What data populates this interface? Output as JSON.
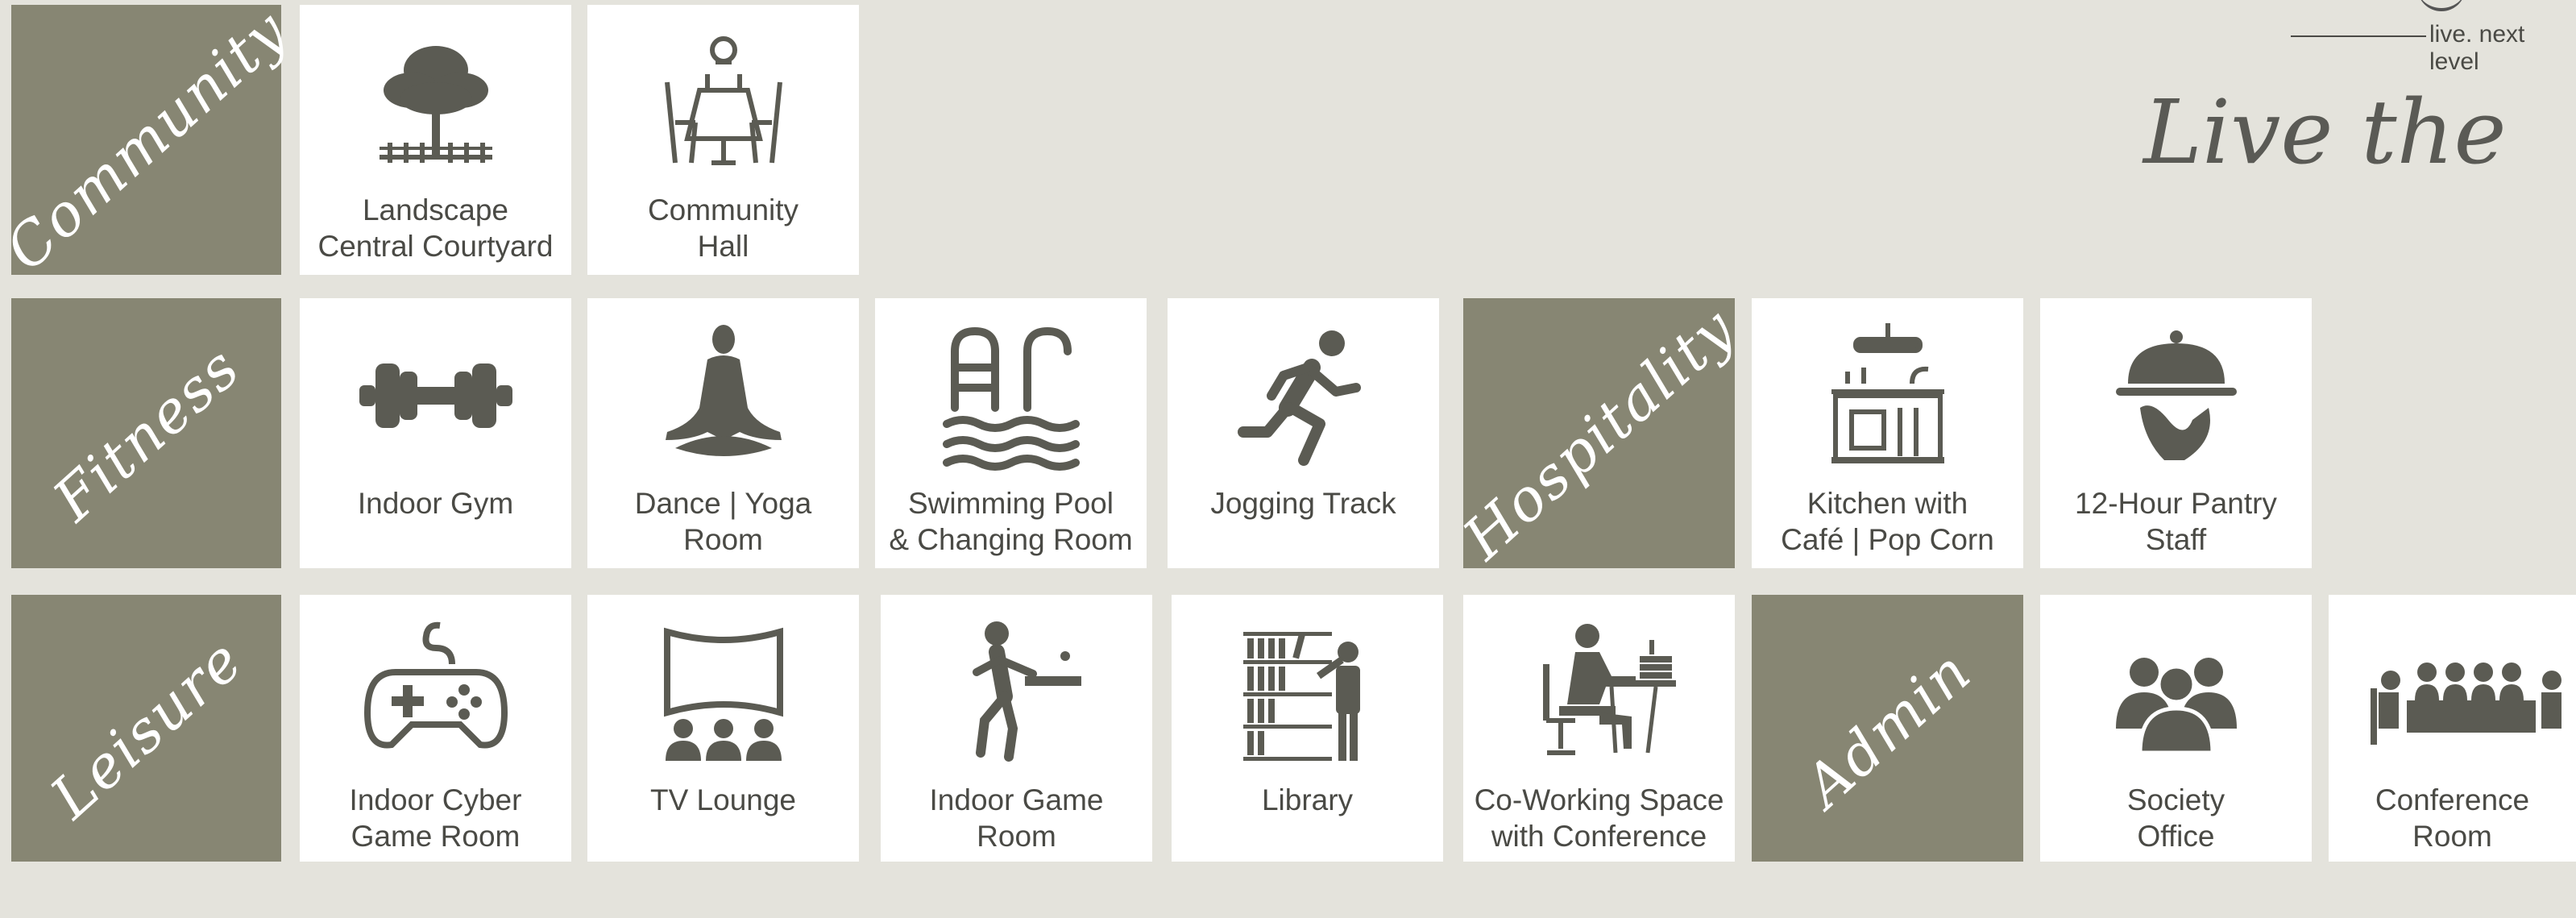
{
  "header": {
    "tagline": "live. next level",
    "slogan": "Live the"
  },
  "categories": {
    "community": "Community",
    "fitness": "Fitness",
    "hospitality": "Hospitality",
    "leisure": "Leisure",
    "admin": "Admin"
  },
  "amenities": {
    "landscape": "Landscape\nCentral Courtyard",
    "community_hall": "Community\nHall",
    "indoor_gym": "Indoor Gym",
    "dance_yoga": "Dance | Yoga\nRoom",
    "swimming_pool": "Swimming Pool\n& Changing Room",
    "jogging_track": "Jogging Track",
    "kitchen": "Kitchen with\nCafé | Pop Corn",
    "pantry": "12-Hour Pantry\nStaff",
    "cyber_game": "Indoor Cyber\nGame Room",
    "tv_lounge": "TV Lounge",
    "indoor_game": "Indoor Game\nRoom",
    "library": "Library",
    "coworking": "Co-Working Space\nwith Conference",
    "society_office": "Society\nOffice",
    "conference_room": "Conference\nRoom"
  },
  "icons": {
    "landscape": "tree-icon",
    "community_hall": "dining-table-icon",
    "indoor_gym": "dumbbell-icon",
    "dance_yoga": "yoga-icon",
    "swimming_pool": "pool-icon",
    "jogging_track": "runner-icon",
    "kitchen": "kitchen-icon",
    "pantry": "cloche-icon",
    "cyber_game": "gamepad-icon",
    "tv_lounge": "theater-icon",
    "indoor_game": "table-tennis-icon",
    "library": "library-icon",
    "coworking": "coworking-icon",
    "society_office": "people-icon",
    "conference_room": "conference-icon"
  },
  "colors": {
    "background": "#e4e3dc",
    "category_tile": "#878673",
    "icon": "#5b5b53",
    "text": "#4a4a45"
  }
}
